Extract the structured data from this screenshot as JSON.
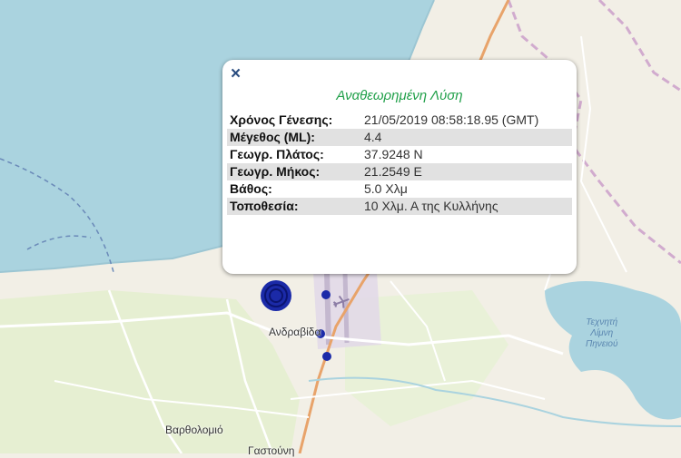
{
  "map": {
    "places": [
      {
        "name": "Ανδραβίδα"
      },
      {
        "name": "Βαρθολομιό"
      },
      {
        "name": "Γαστούνη"
      }
    ],
    "lake_label": [
      "Τεχνητή",
      "Λίμνη",
      "Πηνειού"
    ],
    "colors": {
      "sea": "#aad3df",
      "land": "#f2efe6",
      "farmland": "#e9f2d6",
      "airport": "#e2d9e8",
      "main_road": "#e8a36a",
      "border": "#c89ac8",
      "ferry": "#6a89b8",
      "quake_marker": "#1b2aa8"
    },
    "quake_icon": "concentric-circle-marker",
    "small_quake_icon": "dot-marker",
    "airport_icon": "airplane-icon"
  },
  "popup": {
    "close_symbol": "×",
    "title": "Αναθεωρημένη Λύση",
    "rows": [
      {
        "label": "Χρόνος Γένεσης:",
        "value": "21/05/2019 08:58:18.95 (GMT)"
      },
      {
        "label": "Μέγεθος (ML):",
        "value": "4.4"
      },
      {
        "label": "Γεωγρ. Πλάτος:",
        "value": "37.9248 N"
      },
      {
        "label": "Γεωγρ. Μήκος:",
        "value": "21.2549 E"
      },
      {
        "label": "Βάθος:",
        "value": "5.0 Χλμ"
      },
      {
        "label": "Τοποθεσία:",
        "value": "10 Χλμ. Α της Κυλλήνης"
      }
    ]
  }
}
